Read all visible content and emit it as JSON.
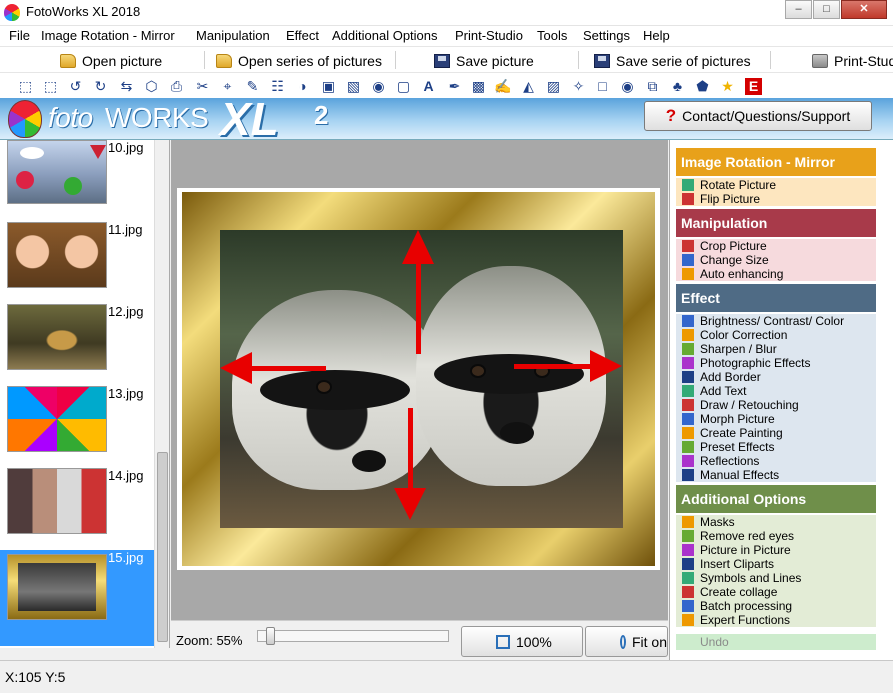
{
  "window": {
    "title": "FotoWorks XL 2018",
    "minimize": "–",
    "maximize": "□",
    "close": "✕"
  },
  "menu": [
    "File",
    "Image Rotation - Mirror",
    "Manipulation",
    "Effect",
    "Additional Options",
    "Print-Studio",
    "Tools",
    "Settings",
    "Help"
  ],
  "toolbar": {
    "open_picture": "Open picture",
    "open_series": "Open series of pictures",
    "save_picture": "Save picture",
    "save_series": "Save serie of pictures",
    "print_studio": "Print-Studio"
  },
  "tools": [
    {
      "name": "rotate-left-icon",
      "glyph": "⬚"
    },
    {
      "name": "rotate-right-icon",
      "glyph": "⬚"
    },
    {
      "name": "rotate-ccw-icon",
      "glyph": "↺"
    },
    {
      "name": "rotate-cw-icon",
      "glyph": "↻"
    },
    {
      "name": "flip-icon",
      "glyph": "⇆"
    },
    {
      "name": "perspective-icon",
      "glyph": "⬡"
    },
    {
      "name": "scan-icon",
      "glyph": "⎙"
    },
    {
      "name": "scissors-icon",
      "glyph": "✂"
    },
    {
      "name": "crop-icon",
      "glyph": "⌖"
    },
    {
      "name": "brush-icon",
      "glyph": "✎"
    },
    {
      "name": "color-balance-icon",
      "glyph": "☷"
    },
    {
      "name": "contrast-icon",
      "glyph": "◑"
    },
    {
      "name": "sharpen-icon",
      "glyph": "▣"
    },
    {
      "name": "photo-effect-icon",
      "glyph": "▧"
    },
    {
      "name": "camera-icon",
      "glyph": "◉"
    },
    {
      "name": "border-icon",
      "glyph": "▢"
    },
    {
      "name": "text-icon",
      "glyph": "A"
    },
    {
      "name": "draw-icon",
      "glyph": "✒"
    },
    {
      "name": "morph-icon",
      "glyph": "▩"
    },
    {
      "name": "paint-icon",
      "glyph": "✍"
    },
    {
      "name": "landscape-icon",
      "glyph": "◭"
    },
    {
      "name": "reflection-icon",
      "glyph": "▨"
    },
    {
      "name": "wand-icon",
      "glyph": "✧"
    },
    {
      "name": "mask-icon",
      "glyph": "□"
    },
    {
      "name": "red-eye-icon",
      "glyph": "◉"
    },
    {
      "name": "picture-in-picture-icon",
      "glyph": "⧉"
    },
    {
      "name": "clipart-icon",
      "glyph": "♣"
    },
    {
      "name": "shapes-icon",
      "glyph": "⬟"
    },
    {
      "name": "collage-icon",
      "glyph": "★"
    },
    {
      "name": "batch-icon",
      "glyph": "≡"
    },
    {
      "name": "expert-icon",
      "glyph": "E"
    }
  ],
  "banner": {
    "logo_part1": "foto",
    "logo_part2": "WORKS",
    "logo_part3": "XL",
    "logo_part4": "2",
    "contact_button": "Contact/Questions/Support"
  },
  "thumbnails": [
    {
      "file": "10.jpg",
      "selected": false
    },
    {
      "file": "11.jpg",
      "selected": false
    },
    {
      "file": "12.jpg",
      "selected": false
    },
    {
      "file": "13.jpg",
      "selected": false
    },
    {
      "file": "14.jpg",
      "selected": false
    },
    {
      "file": "15.jpg",
      "selected": true
    }
  ],
  "zoom": {
    "label": "Zoom: 55%",
    "fit_100": "100%",
    "fit_other": "Fit on"
  },
  "panel": {
    "sections": [
      {
        "title": "Image Rotation - Mirror",
        "color": "#e8a11a",
        "row_bg": "#fde6bf",
        "items": [
          "Rotate Picture",
          "Flip Picture"
        ]
      },
      {
        "title": "Manipulation",
        "color": "#a83a4a",
        "row_bg": "#f6dadd",
        "items": [
          "Crop Picture",
          "Change Size",
          "Auto enhancing"
        ]
      },
      {
        "title": "Effect",
        "color": "#4f6b85",
        "row_bg": "#dde6ef",
        "items": [
          "Brightness/ Contrast/ Color",
          "Color Correction",
          "Sharpen / Blur",
          "Photographic Effects",
          "Add Border",
          "Add Text",
          "Draw / Retouching",
          "Morph Picture",
          "Create Painting",
          "Preset Effects",
          "Reflections",
          "Manual Effects"
        ]
      },
      {
        "title": "Additional Options",
        "color": "#6f8f4a",
        "row_bg": "#e3ecd6",
        "items": [
          "Masks",
          "Remove red eyes",
          "Picture in Picture",
          "Insert Cliparts",
          "Symbols and Lines",
          "Create collage",
          "Batch processing",
          "Expert Functions"
        ]
      }
    ],
    "undo": "Undo"
  },
  "status": {
    "coords": "X:105 Y:5"
  }
}
